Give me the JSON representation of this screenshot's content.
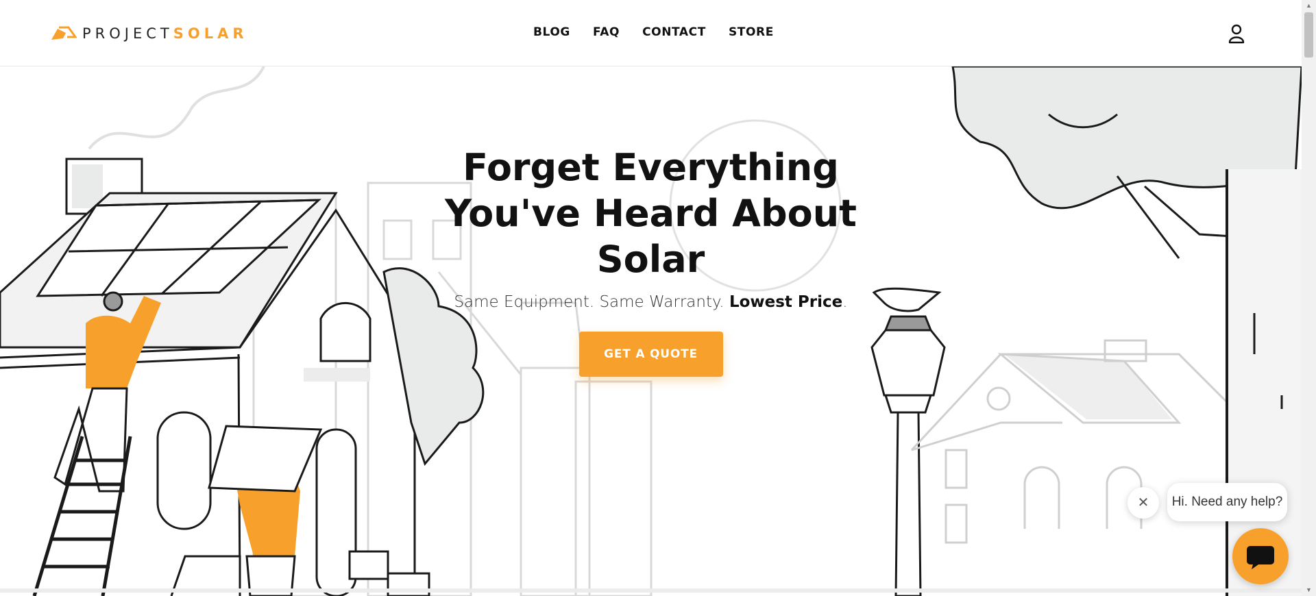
{
  "brand": {
    "name_part1": "PROJECT",
    "name_part2": "SOLAR"
  },
  "nav": {
    "items": [
      "BLOG",
      "FAQ",
      "CONTACT",
      "STORE"
    ]
  },
  "hero": {
    "title": "Forget Everything You've Heard About Solar",
    "subtitle_plain": "Same Equipment. Same Warranty.",
    "subtitle_bold": "Lowest Price",
    "subtitle_end": ".",
    "cta_label": "GET A QUOTE"
  },
  "chat": {
    "greeting": "Hi. Need any help?",
    "close_glyph": "✕"
  },
  "colors": {
    "accent": "#f7a02c",
    "text": "#111111",
    "illustration_line": "#1a1a1a",
    "illustration_fill": "#e9eaea"
  },
  "icons": [
    "logo-mark-icon",
    "account-icon",
    "close-icon",
    "chat-icon"
  ]
}
